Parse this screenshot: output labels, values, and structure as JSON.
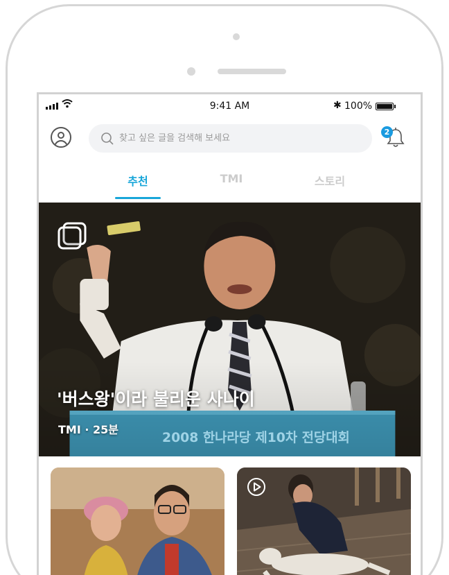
{
  "status_bar": {
    "time": "9:41 AM",
    "bluetooth": "✱",
    "battery_pct": "100%",
    "battery_level": 1.0
  },
  "header": {
    "search_placeholder": "찾고 싶은 글을 검색해 보세요",
    "notification_count": "2"
  },
  "tabs": [
    {
      "label": "추천",
      "active": true
    },
    {
      "label": "TMI",
      "active": false
    },
    {
      "label": "스토리",
      "active": false
    }
  ],
  "hero": {
    "title": "'버스왕'이라 불리운 사나이",
    "meta": "TMI · 25분",
    "banner_text": "2008 한나라당 제10차 전당대회"
  },
  "icons": {
    "avatar": "user-circle-icon",
    "search": "search-icon",
    "bell": "bell-icon",
    "gallery": "copy-icon",
    "play": "play-icon"
  },
  "colors": {
    "accent": "#18a6d9",
    "badge": "#1a9be0",
    "inactive_tab": "#cccccc"
  }
}
